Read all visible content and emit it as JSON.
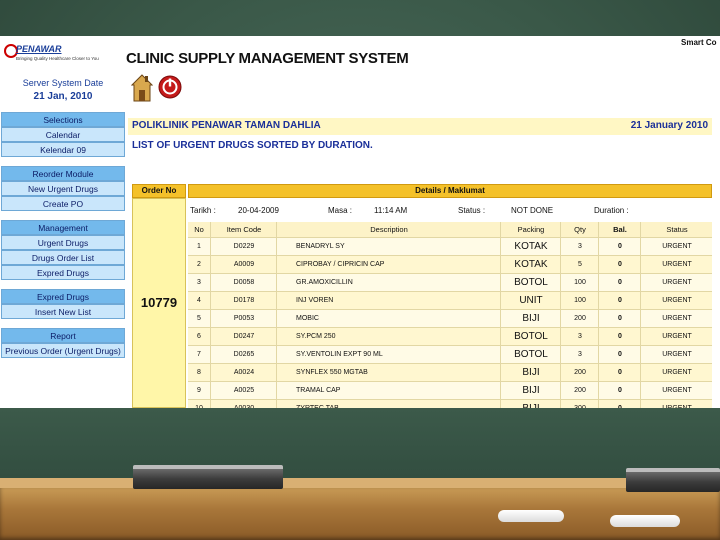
{
  "app": {
    "title": "CLINIC SUPPLY MANAGEMENT SYSTEM",
    "corner_text": "Smart Co"
  },
  "logo": {
    "name": "PENAWAR",
    "tagline": "Bringing Quality Healthcare Closer to You"
  },
  "server": {
    "label": "Server System Date",
    "date": "21 Jan, 2010"
  },
  "sidebar": {
    "groups": [
      {
        "header": "Selections",
        "items": [
          "Calendar",
          "Kelendar 09"
        ]
      },
      {
        "header": "Reorder Module",
        "items": [
          "New Urgent Drugs",
          "Create PO"
        ]
      },
      {
        "header": "Management",
        "items": [
          "Urgent Drugs",
          "Drugs Order List",
          "Expred Drugs"
        ]
      },
      {
        "header": "Expred Drugs",
        "items": [
          "Insert New List"
        ]
      },
      {
        "header": "Report",
        "items": [
          "Previous Order (Urgent Drugs)"
        ]
      }
    ]
  },
  "icons": {
    "home": "home-icon",
    "power": "power-icon"
  },
  "clinic": {
    "name": "POLIKLINIK PENAWAR TAMAN DAHLIA",
    "date": "21 January 2010"
  },
  "list_title": "LIST OF URGENT DRUGS SORTED BY DURATION.",
  "order": {
    "header": "Order No",
    "number": "10779"
  },
  "details": {
    "header": "Details / Maklumat",
    "tarikh_label": "Tarikh :",
    "tarikh_value": "20-04-2009",
    "masa_label": "Masa :",
    "masa_value": "11:14 AM",
    "status_label": "Status :",
    "status_value": "NOT DONE",
    "duration_label": "Duration :"
  },
  "table": {
    "columns": [
      "No",
      "Item Code",
      "Description",
      "Packing",
      "Qty",
      "Bal.",
      "Status"
    ],
    "rows": [
      {
        "no": "1",
        "code": "D0229",
        "desc": "BENADRYL SY",
        "pack": "KOTAK",
        "qty": "3",
        "bal": "0",
        "status": "URGENT"
      },
      {
        "no": "2",
        "code": "A0009",
        "desc": "CIPROBAY / CIPRICIN CAP",
        "pack": "KOTAK",
        "qty": "5",
        "bal": "0",
        "status": "URGENT"
      },
      {
        "no": "3",
        "code": "D0058",
        "desc": "GR.AMOXICILLIN",
        "pack": "BOTOL",
        "qty": "100",
        "bal": "0",
        "status": "URGENT"
      },
      {
        "no": "4",
        "code": "D0178",
        "desc": "INJ VOREN",
        "pack": "UNIT",
        "qty": "100",
        "bal": "0",
        "status": "URGENT"
      },
      {
        "no": "5",
        "code": "P0053",
        "desc": "MOBIC",
        "pack": "BIJI",
        "qty": "200",
        "bal": "0",
        "status": "URGENT"
      },
      {
        "no": "6",
        "code": "D0247",
        "desc": "SY.PCM 250",
        "pack": "BOTOL",
        "qty": "3",
        "bal": "0",
        "status": "URGENT"
      },
      {
        "no": "7",
        "code": "D0265",
        "desc": "SY.VENTOLIN EXPT 90 ML",
        "pack": "BOTOL",
        "qty": "3",
        "bal": "0",
        "status": "URGENT"
      },
      {
        "no": "8",
        "code": "A0024",
        "desc": "SYNFLEX 550 MGTAB",
        "pack": "BIJI",
        "qty": "200",
        "bal": "0",
        "status": "URGENT"
      },
      {
        "no": "9",
        "code": "A0025",
        "desc": "TRAMAL CAP",
        "pack": "BIJI",
        "qty": "200",
        "bal": "0",
        "status": "URGENT"
      },
      {
        "no": "10",
        "code": "A0030",
        "desc": "ZYRTEC TAB",
        "pack": "BIJI",
        "qty": "300",
        "bal": "0",
        "status": "URGENT"
      }
    ]
  }
}
